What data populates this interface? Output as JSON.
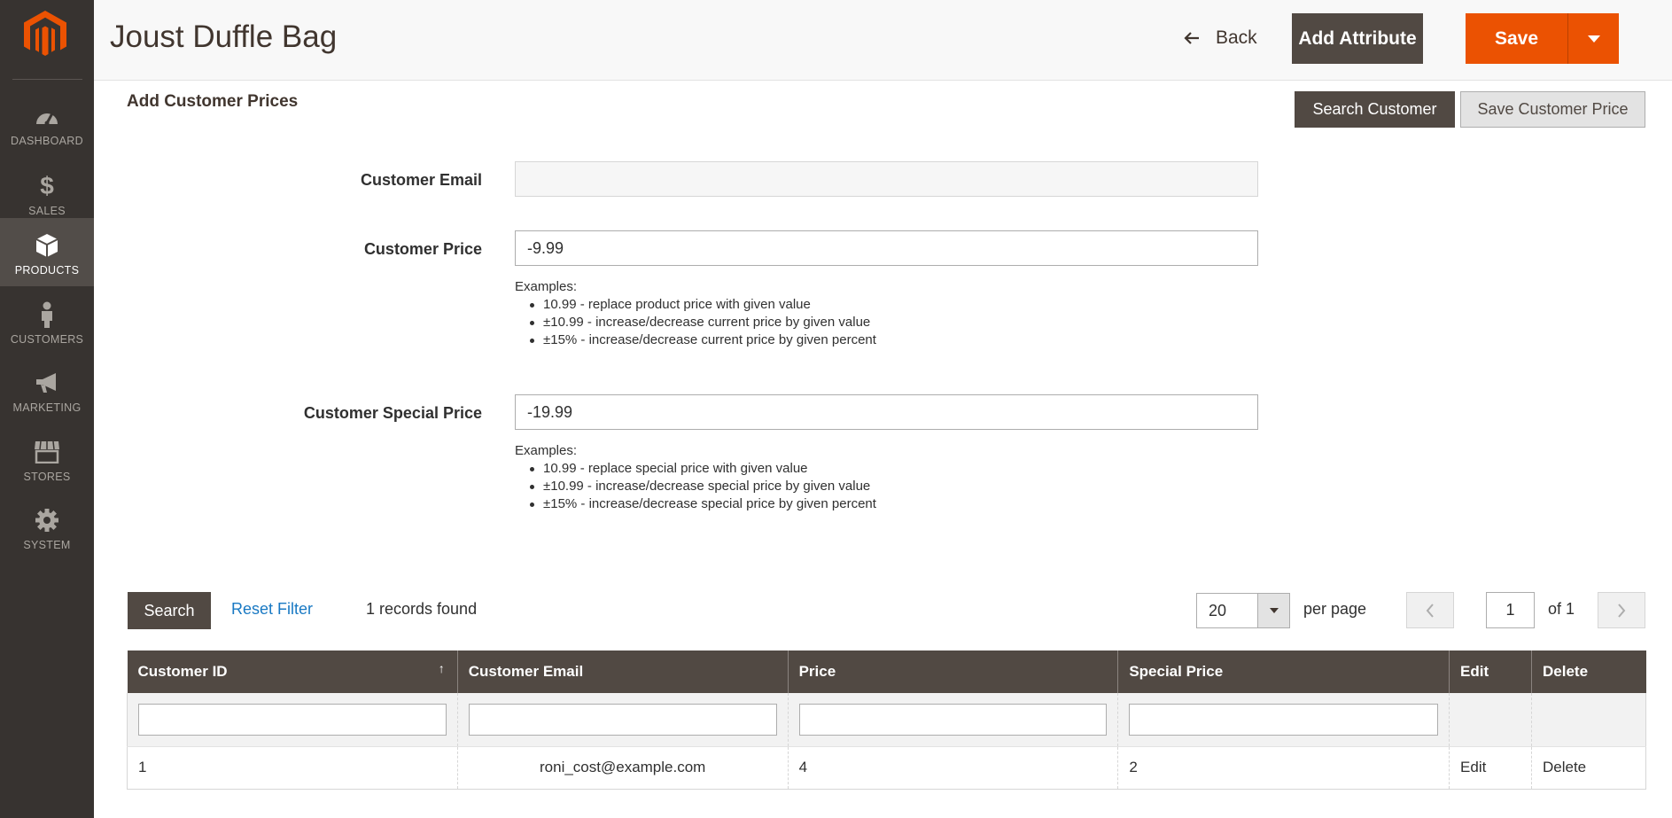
{
  "sidebar": {
    "items": [
      {
        "label": "DASHBOARD",
        "icon": "dashboard-icon"
      },
      {
        "label": "SALES",
        "icon": "dollar-icon"
      },
      {
        "label": "PRODUCTS",
        "icon": "cube-icon"
      },
      {
        "label": "CUSTOMERS",
        "icon": "person-icon"
      },
      {
        "label": "MARKETING",
        "icon": "megaphone-icon"
      },
      {
        "label": "STORES",
        "icon": "store-icon"
      },
      {
        "label": "SYSTEM",
        "icon": "gear-icon"
      }
    ],
    "active": "PRODUCTS"
  },
  "header": {
    "title": "Joust Duffle Bag",
    "back_label": "Back",
    "add_attribute_label": "Add Attribute",
    "save_label": "Save"
  },
  "section": {
    "title": "Add Customer Prices",
    "search_customer_label": "Search Customer",
    "save_customer_price_label": "Save Customer Price"
  },
  "form": {
    "customer_email": {
      "label": "Customer Email",
      "value": ""
    },
    "customer_price": {
      "label": "Customer Price",
      "value": "-9.99"
    },
    "customer_price_examples": {
      "heading": "Examples:",
      "items": [
        "10.99 - replace product price with given value",
        "±10.99 - increase/decrease current price by given value",
        "±15% - increase/decrease current price by given percent"
      ]
    },
    "customer_special_price": {
      "label": "Customer Special Price",
      "value": "-19.99"
    },
    "special_price_examples": {
      "heading": "Examples:",
      "items": [
        "10.99 - replace special price with given value",
        "±10.99 - increase/decrease special price by given value",
        "±15% - increase/decrease special price by given percent"
      ]
    }
  },
  "grid": {
    "search_label": "Search",
    "reset_filter_label": "Reset Filter",
    "records_found": "1 records found",
    "per_page_value": "20",
    "per_page_label": "per page",
    "page_value": "1",
    "page_of": "of 1",
    "columns": [
      "Customer ID",
      "Customer Email",
      "Price",
      "Special Price",
      "Edit",
      "Delete"
    ],
    "sort_indicator": "↑",
    "rows": [
      {
        "customer_id": "1",
        "customer_email": "roni_cost@example.com",
        "price": "4",
        "special_price": "2",
        "edit": "Edit",
        "delete": "Delete"
      }
    ]
  },
  "colors": {
    "sidebar_bg": "#373330",
    "sidebar_active": "#524d49",
    "accent_orange": "#eb5202",
    "dark_button": "#514943",
    "link": "#1979c3"
  }
}
